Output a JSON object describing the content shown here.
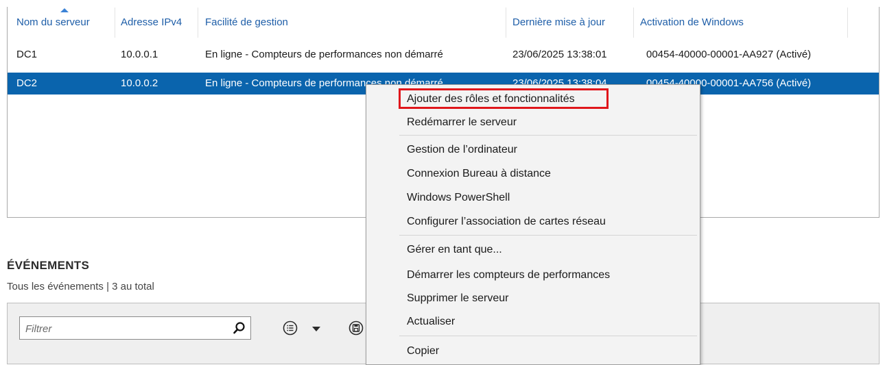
{
  "servers": {
    "columns": [
      "Nom du serveur",
      "Adresse IPv4",
      "Facilité de gestion",
      "Dernière mise à jour",
      "Activation de Windows"
    ],
    "rows": [
      {
        "name": "DC1",
        "ip": "10.0.0.1",
        "status": "En ligne - Compteurs de performances non démarré",
        "updated": "23/06/2025 13:38:01",
        "activation": "00454-40000-00001-AA927 (Activé)",
        "selected": false
      },
      {
        "name": "DC2",
        "ip": "10.0.0.2",
        "status": "En ligne - Compteurs de performances non démarré",
        "updated": "23/06/2025 13:38:04",
        "activation": "00454-40000-00001-AA756 (Activé)",
        "selected": true
      }
    ]
  },
  "events": {
    "title": "ÉVÉNEMENTS",
    "subtitle": "Tous les événements | 3 au total",
    "filter_placeholder": "Filtrer"
  },
  "context_menu": {
    "items": [
      "Ajouter des rôles et fonctionnalités",
      "Redémarrer le serveur",
      "Gestion de l’ordinateur",
      "Connexion Bureau à distance",
      "Windows PowerShell",
      "Configurer l’association de cartes réseau",
      "Gérer en tant que...",
      "Démarrer les compteurs de performances",
      "Supprimer le serveur",
      "Actualiser",
      "Copier"
    ],
    "highlighted_item": "Ajouter des rôles et fonctionnalités"
  },
  "colors": {
    "header_text": "#1e5ea8",
    "selection": "#0a64ad",
    "highlight_border": "#e0161b"
  },
  "icons": [
    "search-icon",
    "list-icon",
    "chevron-down-icon",
    "save-icon",
    "sort-ascending-icon"
  ]
}
